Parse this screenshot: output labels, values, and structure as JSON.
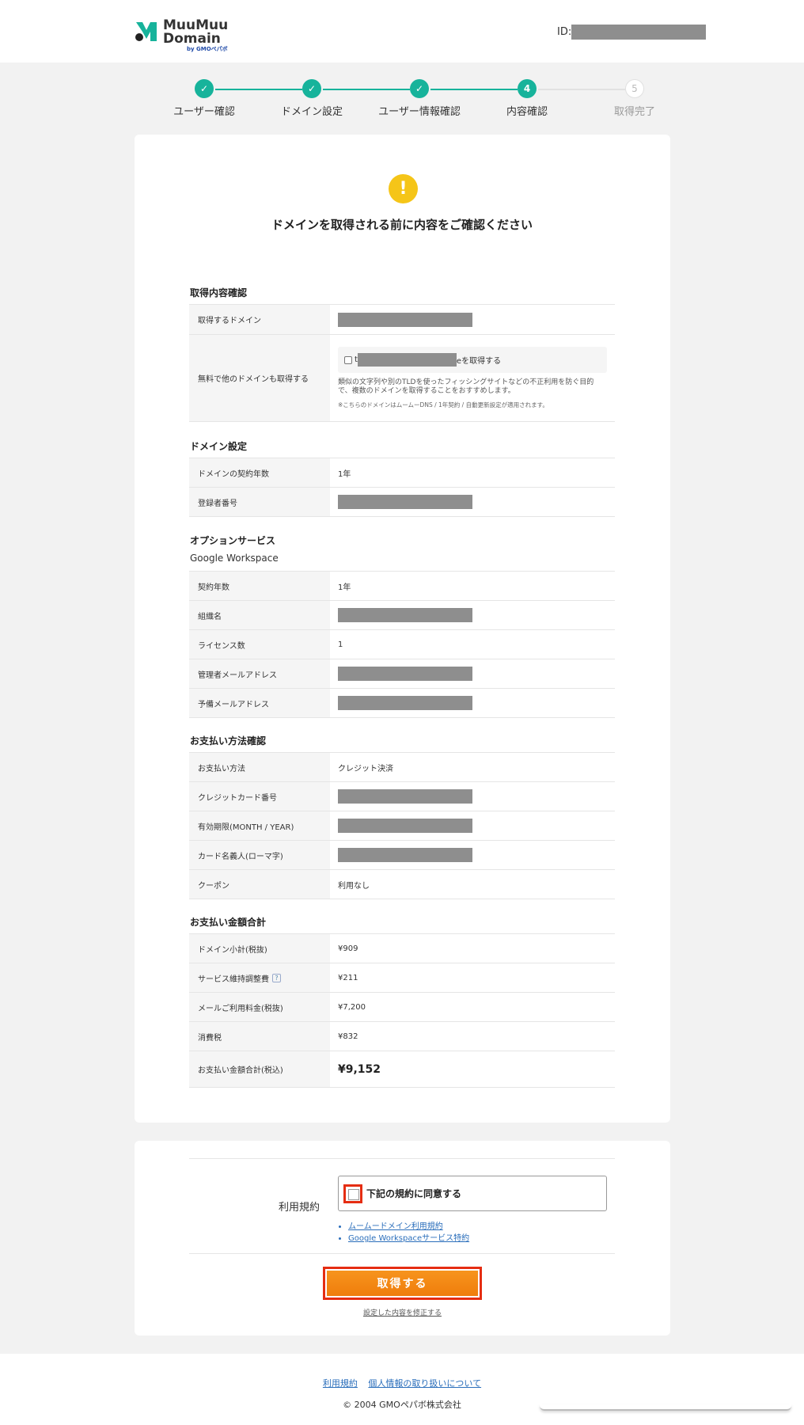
{
  "header": {
    "logo_line1": "MuuMuu",
    "logo_line2": "Domain",
    "logo_sub": "by GMOペパボ",
    "id_label": "ID:"
  },
  "steps": [
    {
      "label": "ユーザー確認",
      "state": "done"
    },
    {
      "label": "ドメイン設定",
      "state": "done"
    },
    {
      "label": "ユーザー情報確認",
      "state": "done"
    },
    {
      "label": "内容確認",
      "number": "4",
      "state": "current"
    },
    {
      "label": "取得完了",
      "number": "5",
      "state": "pending"
    }
  ],
  "confirm": {
    "icon": "!",
    "title": "ドメインを取得される前に内容をご確認ください"
  },
  "acquisition": {
    "title": "取得内容確認",
    "domain_label": "取得するドメイン",
    "free_label": "無料で他のドメインも取得する",
    "free_checkbox_prefix": "t",
    "free_checkbox_suffix": "eを取得する",
    "free_note": "類似の文字列や別のTLDを使ったフィッシングサイトなどの不正利用を防ぐ目的で、複数のドメインを取得することをおすすめします。",
    "free_small": "※こちらのドメインはムームーDNS / 1年契約 / 自動更新設定が適用されます。"
  },
  "domain_settings": {
    "title": "ドメイン設定",
    "years_label": "ドメインの契約年数",
    "years_value": "1年",
    "registrant_label": "登録者番号"
  },
  "options": {
    "title": "オプションサービス",
    "service": "Google Workspace",
    "rows": {
      "years_label": "契約年数",
      "years_value": "1年",
      "org_label": "組織名",
      "license_label": "ライセンス数",
      "license_value": "1",
      "admin_email_label": "管理者メールアドレス",
      "spare_email_label": "予備メールアドレス"
    }
  },
  "payment": {
    "title": "お支払い方法確認",
    "method_label": "お支払い方法",
    "method_value": "クレジット決済",
    "card_label": "クレジットカード番号",
    "expiry_label": "有効期限(MONTH / YEAR)",
    "holder_label": "カード名義人(ローマ字)",
    "coupon_label": "クーポン",
    "coupon_value": "利用なし"
  },
  "totals": {
    "title": "お支払い金額合計",
    "domain_subtotal_label": "ドメイン小計(税抜)",
    "domain_subtotal_value": "¥909",
    "service_fee_label": "サービス維持調整費",
    "service_fee_help": "?",
    "service_fee_value": "¥211",
    "mail_fee_label": "メールご利用料金(税抜)",
    "mail_fee_value": "¥7,200",
    "tax_label": "消費税",
    "tax_value": "¥832",
    "total_label": "お支払い金額合計(税込)",
    "total_value": "¥9,152"
  },
  "terms": {
    "label": "利用規約",
    "agree_text": "下記の規約に同意する",
    "links": [
      "ムームードメイン利用規約",
      "Google Workspaceサービス特約"
    ]
  },
  "actions": {
    "submit_label": "取得する",
    "modify_link": "設定した内容を修正する"
  },
  "footer": {
    "links": [
      "利用規約",
      "個人情報の取り扱いについて"
    ],
    "copyright": "© 2004 GMOペパボ株式会社"
  },
  "colors": {
    "accent": "#17b39b",
    "warning": "#f5c518",
    "button": "#f7941d",
    "highlight": "#e52d12",
    "link": "#2a6ebb"
  }
}
